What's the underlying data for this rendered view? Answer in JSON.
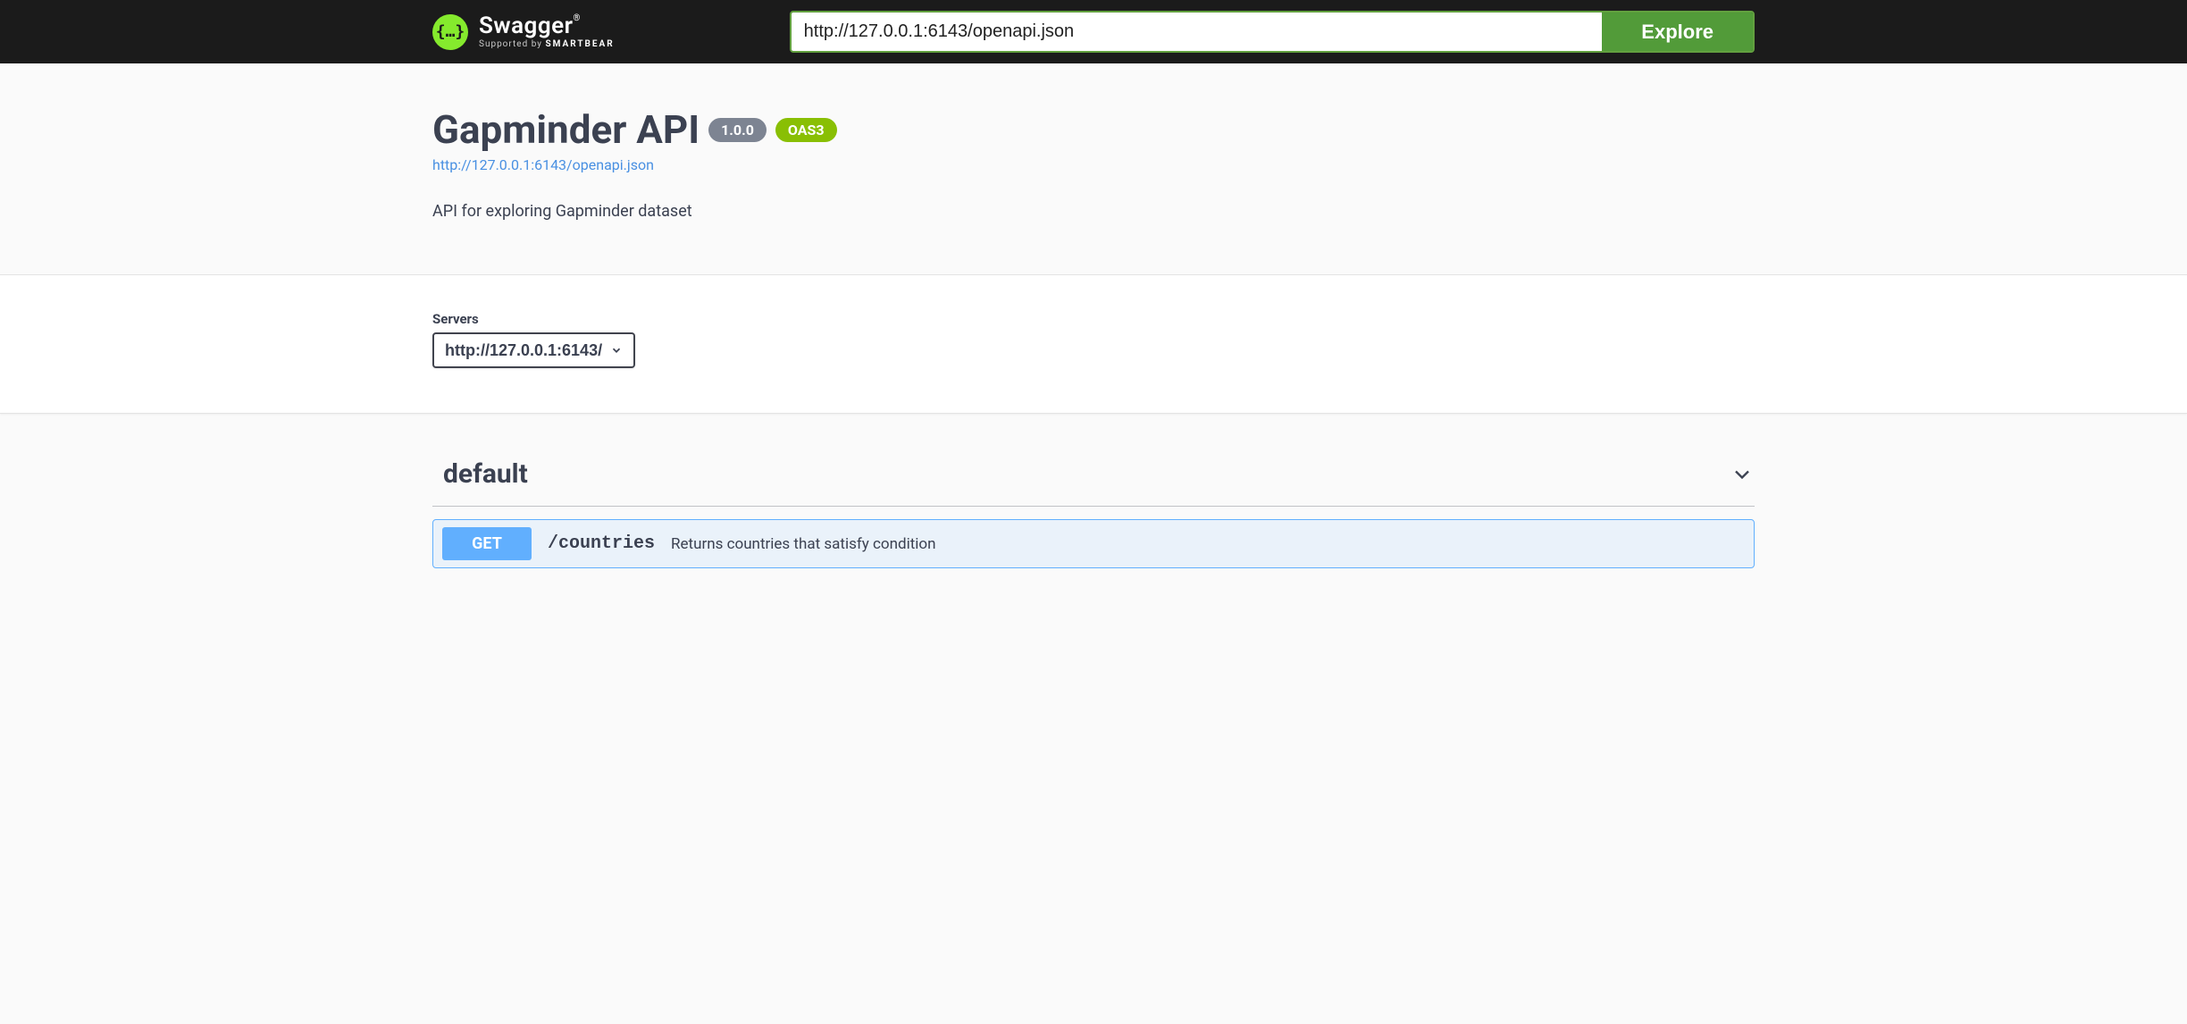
{
  "topbar": {
    "logo_word": "Swagger",
    "logo_supported_prefix": "Supported by ",
    "logo_supported_brand": "SMARTBEAR",
    "spec_url_value": "http://127.0.0.1:6143/openapi.json",
    "explore_label": "Explore"
  },
  "info": {
    "title": "Gapminder API",
    "version": "1.0.0",
    "oas_badge": "OAS3",
    "spec_link": "http://127.0.0.1:6143/openapi.json",
    "description": "API for exploring Gapminder dataset"
  },
  "servers": {
    "label": "Servers",
    "selected": "http://127.0.0.1:6143/"
  },
  "tags": {
    "default": {
      "name": "default"
    }
  },
  "operations": {
    "get_countries": {
      "method": "GET",
      "path": "/countries",
      "summary": "Returns countries that satisfy condition"
    }
  }
}
